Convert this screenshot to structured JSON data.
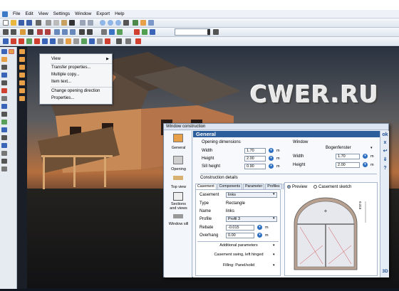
{
  "menu": [
    "File",
    "Edit",
    "View",
    "Settings",
    "Window",
    "Export",
    "Help"
  ],
  "watermark": "CWER.RU",
  "context_menu": {
    "items": [
      "View",
      "Transfer properties...",
      "Multiple copy...",
      "Item text...",
      "Change opening direction",
      "Properties..."
    ]
  },
  "dialog": {
    "title": "Window construction",
    "header": "General",
    "nav": [
      "General",
      "Opening",
      "Top view",
      "Sections and views",
      "Window sill"
    ],
    "opening_dimensions": {
      "title": "Opening dimensions",
      "rows": [
        {
          "label": "Width",
          "value": "1.70",
          "unit": "m"
        },
        {
          "label": "Height",
          "value": "2.00",
          "unit": "m"
        },
        {
          "label": "Sill height",
          "value": "0.90",
          "unit": "m"
        }
      ]
    },
    "window": {
      "title": "Window",
      "type": "Bogenfenster",
      "rows": [
        {
          "label": "Width",
          "value": "1.70",
          "unit": "m"
        },
        {
          "label": "Height",
          "value": "2.00",
          "unit": "m"
        }
      ]
    },
    "construction_title": "Construction details",
    "tabs": [
      "Casement",
      "Components",
      "Parameter",
      "Profiles"
    ],
    "casement": {
      "selector_label": "Casement",
      "selector_value": "links",
      "type_label": "Type",
      "type_value": "Rectangle",
      "name_label": "Name",
      "name_value": "links",
      "profile_label": "Profile",
      "profile_value": "Profil 3",
      "rebate_label": "Rebate",
      "rebate_value": "-0.015",
      "rebate_unit": "m",
      "overhang_label": "Overhang",
      "overhang_value": "0.00",
      "overhang_unit": "m",
      "additional": "Additional parameters",
      "opening": "Casement swing, left hinged",
      "filling": "Filling: Panel/solid"
    },
    "preview": {
      "radio_preview": "Preview",
      "radio_sketch": "Casement sketch",
      "dimension_label": "0.315"
    },
    "right_buttons": [
      "ok",
      "x",
      "↩",
      "⇓",
      "?"
    ],
    "badge_3d": "3D"
  },
  "colors": {
    "accent": "#2c5e9c",
    "dialog_bg": "#ecf1f8"
  }
}
